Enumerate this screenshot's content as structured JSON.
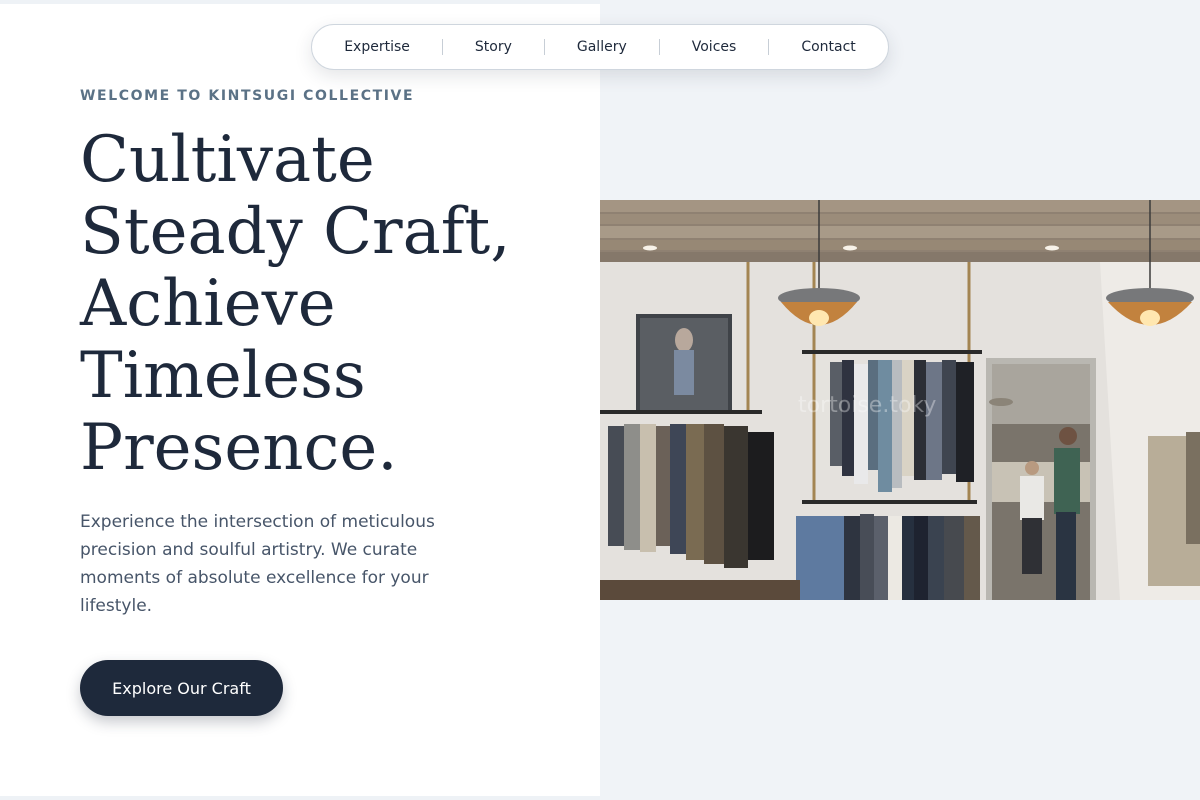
{
  "nav": {
    "items": [
      {
        "label": "Expertise"
      },
      {
        "label": "Story"
      },
      {
        "label": "Gallery"
      },
      {
        "label": "Voices"
      },
      {
        "label": "Contact"
      }
    ]
  },
  "hero": {
    "eyebrow": "WELCOME TO KINTSUGI COLLECTIVE",
    "headline_lines": [
      "Cultivate",
      "Steady Craft,",
      "Achieve",
      "Timeless",
      "Presence."
    ],
    "body": "Experience the intersection of meticulous precision and soulful artistry. We curate moments of absolute excellence for your lifestyle.",
    "cta_label": "Explore Our Craft",
    "image_watermark": "tortoise.toky"
  },
  "colors": {
    "primary": "#1e293b",
    "eyebrow": "#5b7286",
    "body_text": "#475569",
    "panel_bg": "#f0f3f7"
  }
}
